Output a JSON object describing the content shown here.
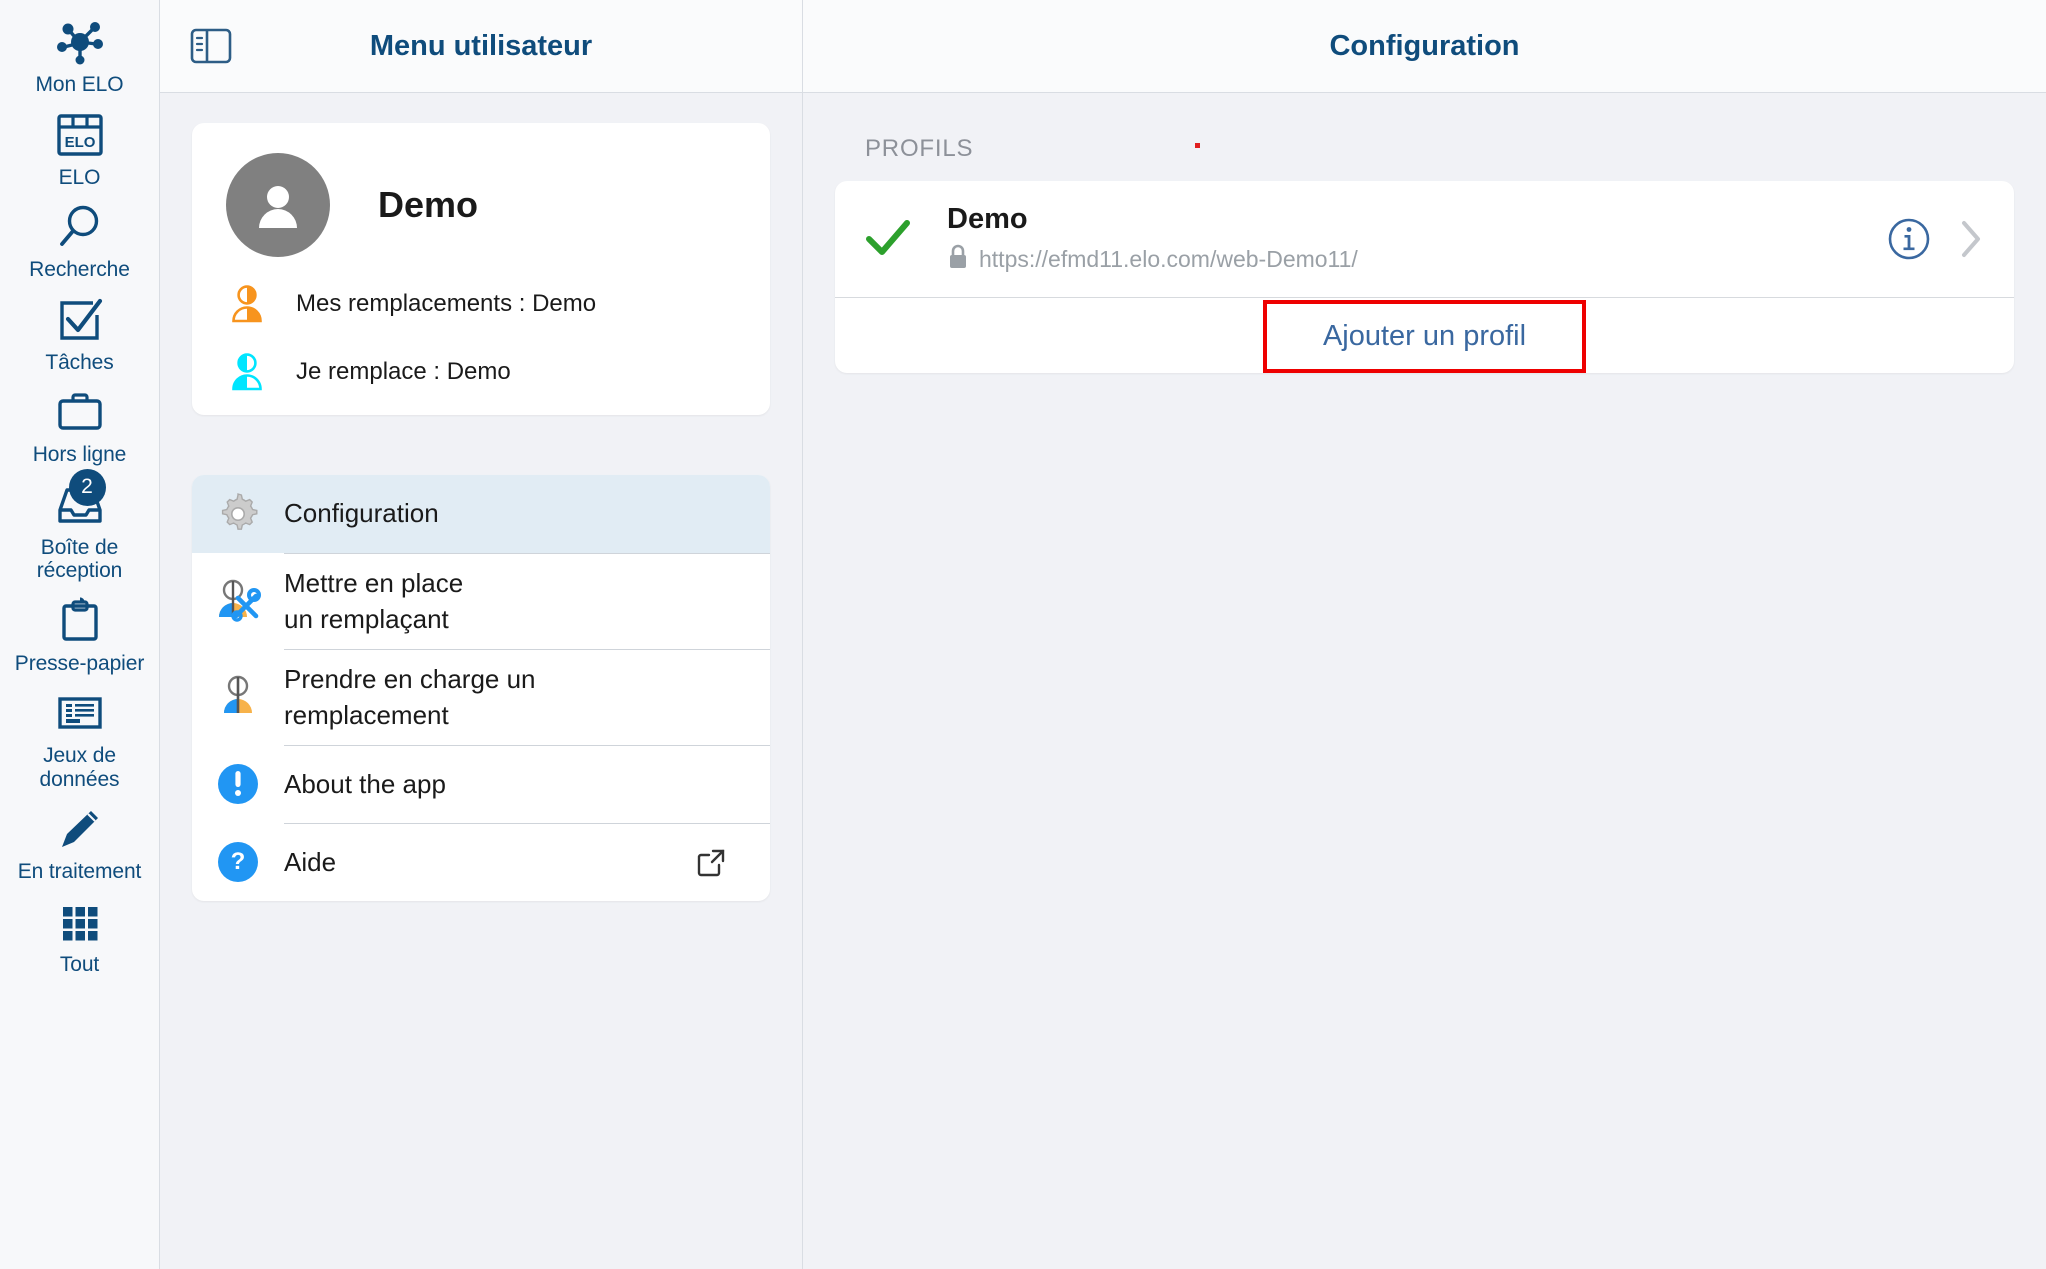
{
  "rail": {
    "items": [
      {
        "label": "Mon ELO",
        "icon": "network-hub-icon",
        "badge": null
      },
      {
        "label": "ELO",
        "icon": "elo-archive-icon",
        "badge": null
      },
      {
        "label": "Recherche",
        "icon": "search-icon",
        "badge": null
      },
      {
        "label": "Tâches",
        "icon": "checkbox-check-icon",
        "badge": null
      },
      {
        "label": "Hors ligne",
        "icon": "briefcase-icon",
        "badge": null
      },
      {
        "label": "Boîte de\nréception",
        "icon": "inbox-tray-icon",
        "badge": "2"
      },
      {
        "label": "Presse-papier",
        "icon": "clipboard-icon",
        "badge": null
      },
      {
        "label": "Jeux de\ndonnées",
        "icon": "data-record-icon",
        "badge": null
      },
      {
        "label": "En traitement",
        "icon": "pencil-icon",
        "badge": null
      },
      {
        "label": "Tout",
        "icon": "grid-all-icon",
        "badge": null
      }
    ]
  },
  "middle": {
    "header": {
      "title": "Menu utilisateur",
      "toggle_icon": "panel-toggle-icon"
    },
    "user": {
      "name": "Demo",
      "avatar_icon": "person-avatar-icon",
      "lines": [
        {
          "icon": "person-substitute-orange-icon",
          "text": "Mes remplacements : Demo"
        },
        {
          "icon": "person-substitute-cyan-icon",
          "text": "Je remplace : Demo"
        }
      ]
    },
    "menu": [
      {
        "label": "Configuration",
        "icon": "gear-icon",
        "active": true,
        "external": false
      },
      {
        "label": "Mettre en place\nun remplaçant",
        "icon": "person-wrench-icon",
        "active": false,
        "external": false
      },
      {
        "label": "Prendre en charge un\nremplacement",
        "icon": "person-split-icon",
        "active": false,
        "external": false
      },
      {
        "label": "About the app",
        "icon": "info-exclamation-icon",
        "active": false,
        "external": false
      },
      {
        "label": "Aide",
        "icon": "question-help-icon",
        "active": false,
        "external": true
      }
    ]
  },
  "right": {
    "header": {
      "title": "Configuration"
    },
    "section_label": "PROFILS",
    "profiles": [
      {
        "name": "Demo",
        "url": "https://efmd11.elo.com/web-Demo11/",
        "selected": true,
        "lock_icon": "lock-icon",
        "info_icon": "info-circle-icon",
        "chevron_icon": "chevron-right-icon"
      }
    ],
    "add_profile_label": "Ajouter un profil"
  },
  "colors": {
    "brand_blue": "#0f4c7c",
    "accent_blue": "#3a68a0",
    "highlight_red": "#ee0000",
    "check_green": "#2ca02c",
    "icon_blue": "#2196f3",
    "icon_orange": "#f7941e",
    "icon_cyan": "#00e5ff"
  }
}
